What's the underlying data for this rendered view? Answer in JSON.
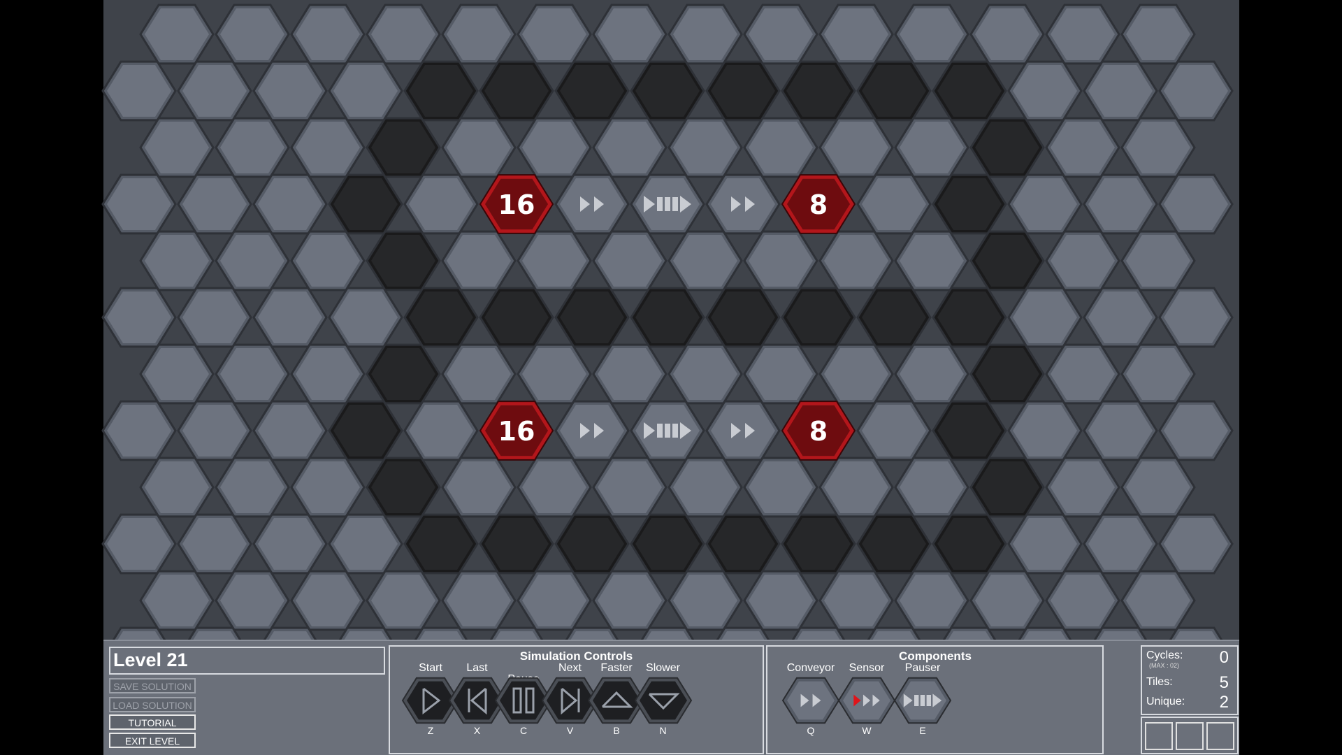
{
  "level": {
    "title": "Level 21"
  },
  "menu": {
    "save_solution": "SAVE SOLUTION",
    "load_solution": "LOAD SOLUTION",
    "tutorial": "TUTORIAL",
    "exit_level": "EXIT LEVEL"
  },
  "simulation": {
    "title": "Simulation Controls",
    "buttons": [
      {
        "label": "Start",
        "key": "Z",
        "icon": "play-icon"
      },
      {
        "label": "Last",
        "key": "X",
        "icon": "step-back-icon"
      },
      {
        "label": "Pause",
        "key": "C",
        "icon": "pause-icon"
      },
      {
        "label": "Next",
        "key": "V",
        "icon": "step-forward-icon"
      },
      {
        "label": "Faster",
        "key": "B",
        "icon": "triangle-up-icon"
      },
      {
        "label": "Slower",
        "key": "N",
        "icon": "triangle-down-icon"
      }
    ]
  },
  "components": {
    "title": "Components",
    "items": [
      {
        "label": "Conveyor",
        "key": "Q",
        "icon": "conveyor-icon"
      },
      {
        "label": "Sensor",
        "key": "W",
        "icon": "sensor-icon"
      },
      {
        "label": "Pauser",
        "key": "E",
        "icon": "pauser-icon"
      }
    ]
  },
  "stats": {
    "cycles_label": "Cycles:",
    "cycles_max": "(MAX : 02)",
    "cycles_value": "0",
    "tiles_label": "Tiles:",
    "tiles_value": "5",
    "unique_label": "Unique:",
    "unique_value": "2"
  },
  "board": {
    "colors": {
      "floor": "#6d737f",
      "floor_rim": "#555b66",
      "wall": "#262729",
      "wall_rim": "#1a1a1b",
      "node": "#6e0c0f",
      "node_rim": "#b3161b",
      "arrow": "#c9ccd2"
    },
    "nodes": [
      {
        "value": "16",
        "row": 3,
        "col": 5
      },
      {
        "value": "8",
        "row": 3,
        "col": 9
      },
      {
        "value": "16",
        "row": 7,
        "col": 5
      },
      {
        "value": "8",
        "row": 7,
        "col": 9
      }
    ],
    "tiles": [
      {
        "type": "conveyor",
        "row": 3,
        "col": 6
      },
      {
        "type": "pauser",
        "row": 3,
        "col": 7
      },
      {
        "type": "conveyor",
        "row": 3,
        "col": 8
      },
      {
        "type": "conveyor",
        "row": 7,
        "col": 6
      },
      {
        "type": "pauser",
        "row": 7,
        "col": 7
      },
      {
        "type": "conveyor",
        "row": 7,
        "col": 8
      }
    ],
    "walls": [
      [
        1,
        4
      ],
      [
        1,
        5
      ],
      [
        1,
        6
      ],
      [
        1,
        7
      ],
      [
        1,
        8
      ],
      [
        1,
        9
      ],
      [
        1,
        10
      ],
      [
        1,
        11
      ],
      [
        2,
        3
      ],
      [
        2,
        11
      ],
      [
        3,
        3
      ],
      [
        3,
        11
      ],
      [
        4,
        3
      ],
      [
        4,
        11
      ],
      [
        5,
        4
      ],
      [
        5,
        5
      ],
      [
        5,
        6
      ],
      [
        5,
        7
      ],
      [
        5,
        8
      ],
      [
        5,
        9
      ],
      [
        5,
        10
      ],
      [
        5,
        11
      ],
      [
        6,
        3
      ],
      [
        6,
        11
      ],
      [
        7,
        3
      ],
      [
        7,
        11
      ],
      [
        8,
        3
      ],
      [
        8,
        11
      ],
      [
        9,
        4
      ],
      [
        9,
        5
      ],
      [
        9,
        6
      ],
      [
        9,
        7
      ],
      [
        9,
        8
      ],
      [
        9,
        9
      ],
      [
        9,
        10
      ],
      [
        9,
        11
      ]
    ]
  }
}
